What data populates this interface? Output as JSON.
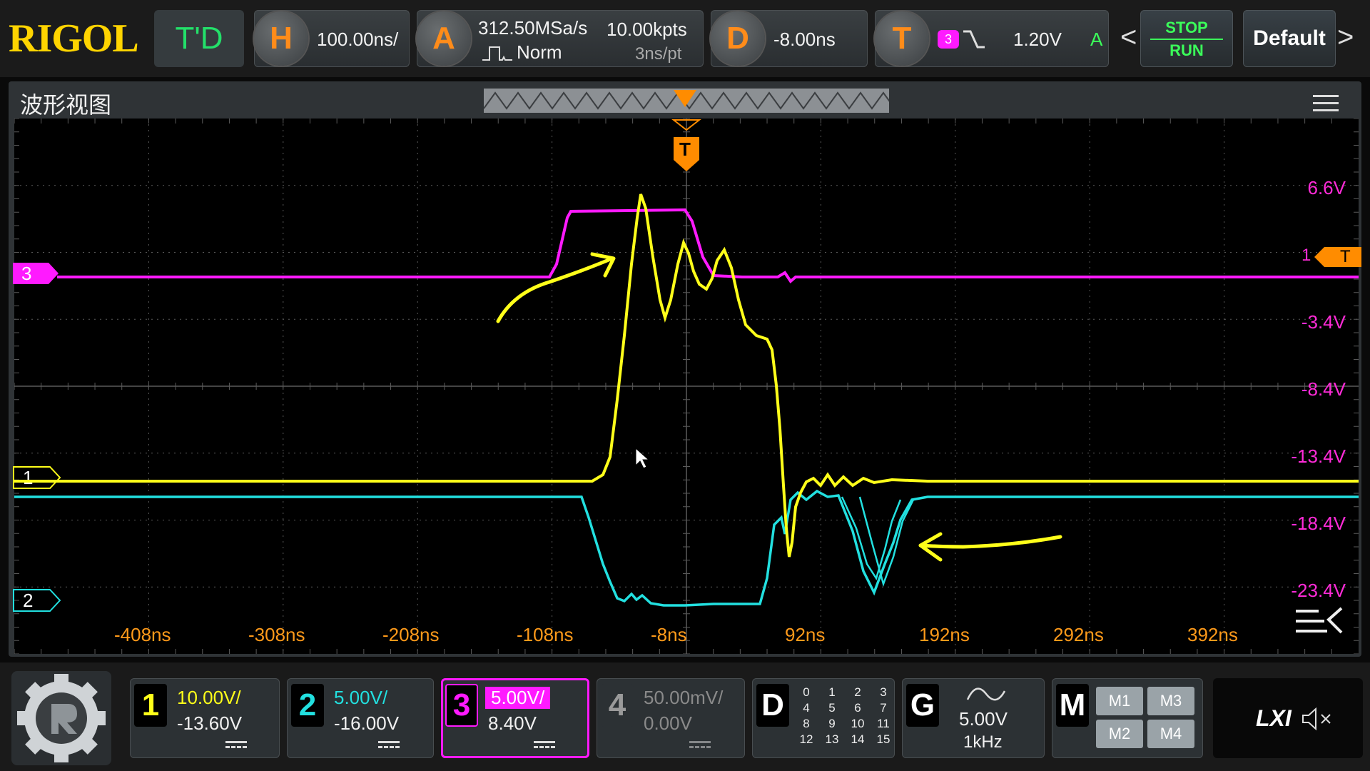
{
  "topbar": {
    "logo": "RIGOL",
    "mode": "T'D",
    "horizontal": {
      "icon_letter": "H",
      "timebase": "100.00ns/"
    },
    "acquire": {
      "icon_letter": "A",
      "sample_rate": "312.50MSa/s",
      "memory": "10.00kpts",
      "acq_mode": "Norm",
      "time_per_pt": "3ns/pt"
    },
    "delay": {
      "icon_letter": "D",
      "value": "-8.00ns"
    },
    "trigger": {
      "icon_letter": "T",
      "source": "3",
      "level": "1.20V",
      "mode": "A"
    },
    "stop_label": "STOP",
    "run_label": "RUN",
    "default_label": "Default",
    "prev_symbol": "<",
    "next_symbol": ">"
  },
  "waveform_view": {
    "title": "波形视图",
    "time_labels": [
      "-408ns",
      "-308ns",
      "-208ns",
      "-108ns",
      "-8ns",
      "92ns",
      "192ns",
      "292ns",
      "392ns"
    ],
    "volt_labels": [
      "6.6V",
      "-3.4V",
      "-8.4V",
      "-13.4V",
      "-18.4V",
      "-23.4V"
    ],
    "trigger_marker": "T",
    "trigger_level_marker": "T",
    "trigger_level_prefix": "1",
    "ch3_marker": "3",
    "ch1_marker": "1",
    "ch2_marker": "2",
    "colors": {
      "ch1": "#ffff1a",
      "ch2": "#22e0e0",
      "ch3": "#ff1aff",
      "trigger": "#ff8c00",
      "grid": "#5a5a5a",
      "annotation": "#ffff1a"
    }
  },
  "channels": [
    {
      "num": "1",
      "scale": "10.00V/",
      "offset": "-13.60V",
      "color": "#ffff1a"
    },
    {
      "num": "2",
      "scale": "5.00V/",
      "offset": "-16.00V",
      "color": "#22e0e0"
    },
    {
      "num": "3",
      "scale": "5.00V/",
      "offset": "8.40V",
      "color": "#ff1aff"
    },
    {
      "num": "4",
      "scale": "50.00mV/",
      "offset": "0.00V",
      "color": "#9a9a9a"
    }
  ],
  "digital": {
    "label": "D",
    "bits": [
      "0",
      "1",
      "2",
      "3",
      "4",
      "5",
      "6",
      "7",
      "8",
      "9",
      "10",
      "11",
      "12",
      "13",
      "14",
      "15"
    ]
  },
  "generator": {
    "label": "G",
    "amplitude": "5.00V",
    "frequency": "1kHz"
  },
  "math": {
    "label": "M",
    "buttons": [
      "M1",
      "M3",
      "M2",
      "M4"
    ]
  },
  "lxi": {
    "label": "LXI"
  }
}
